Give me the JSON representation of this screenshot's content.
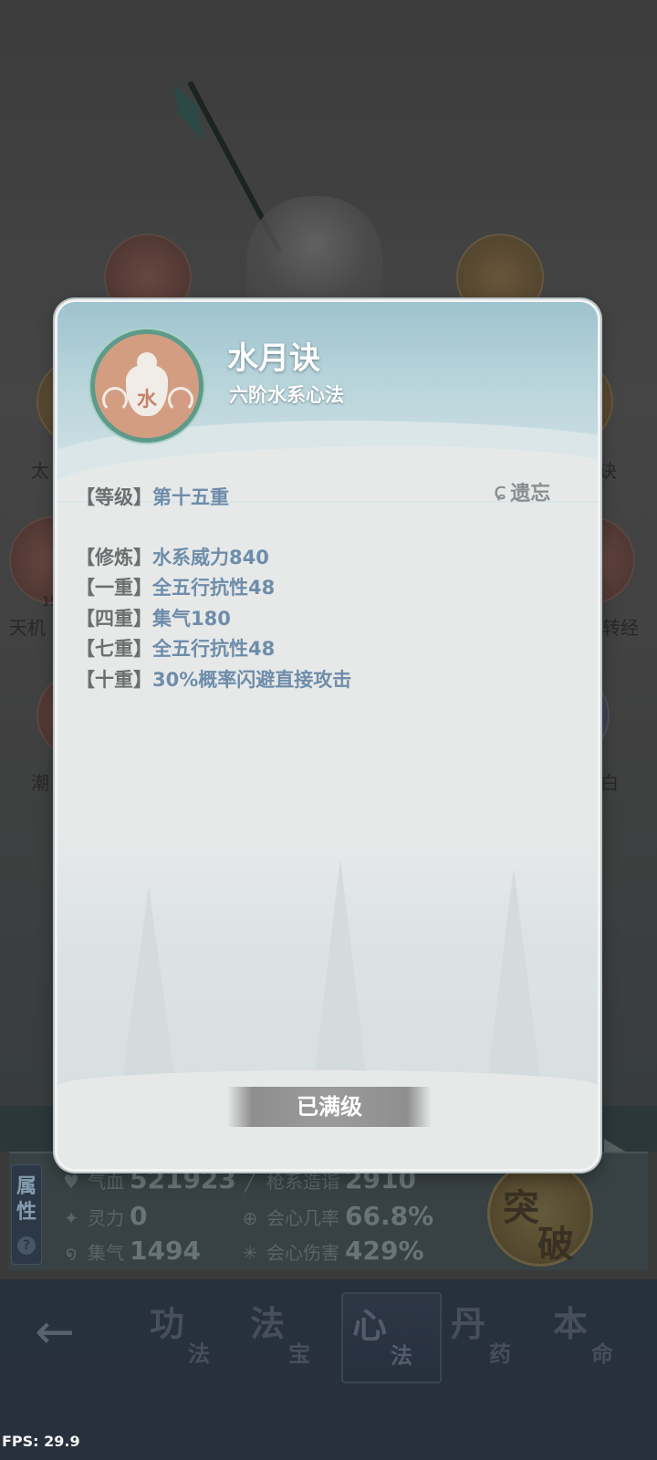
{
  "background": {
    "node_labels": [
      "太",
      "天机",
      "潮",
      "诀",
      "心转经",
      "白"
    ],
    "node_number_hint": "15"
  },
  "skill_modal": {
    "title": "水月诀",
    "subtitle": "六阶水系心法",
    "emblem_char": "水",
    "forget_label": "遗忘",
    "level_line": {
      "tag": "【等级】",
      "value": "第十五重"
    },
    "effects": [
      {
        "tag": "【修炼】",
        "value": "水系威力840"
      },
      {
        "tag": "【一重】",
        "value": "全五行抗性48"
      },
      {
        "tag": "【四重】",
        "value": "集气180"
      },
      {
        "tag": "【七重】",
        "value": "全五行抗性48"
      },
      {
        "tag": "【十重】",
        "value": "30%概率闪避直接攻击"
      }
    ],
    "maxed_label": "已满级"
  },
  "attributes": {
    "tag_label_1": "属",
    "tag_label_2": "性",
    "help_icon": "?",
    "stats": [
      {
        "icon": "heart-icon",
        "glyph": "♥",
        "label": "气血",
        "value": "521923"
      },
      {
        "icon": "spirit-flame-icon",
        "glyph": "✦",
        "label": "灵力",
        "value": "0"
      },
      {
        "icon": "swirl-icon",
        "glyph": "໑",
        "label": "集气",
        "value": "1494"
      },
      {
        "icon": "spear-icon",
        "glyph": "╱",
        "label": "枪系造诣",
        "value": "2910"
      },
      {
        "icon": "crit-target-icon",
        "glyph": "⊕",
        "label": "会心几率",
        "value": "66.8%"
      },
      {
        "icon": "burst-icon",
        "glyph": "✳",
        "label": "会心伤害",
        "value": "429%"
      }
    ],
    "breakthrough": {
      "char1": "突",
      "char2": "破"
    }
  },
  "bottom_nav": {
    "back_glyph": "←",
    "items": [
      {
        "big": "功",
        "small": "法",
        "active": false
      },
      {
        "big": "法",
        "small": "宝",
        "active": false
      },
      {
        "big": "心",
        "small": "法",
        "active": true
      },
      {
        "big": "丹",
        "small": "药",
        "active": false
      },
      {
        "big": "本",
        "small": "命",
        "active": false
      }
    ]
  },
  "fps": "FPS: 29.9",
  "colors": {
    "accent_value": "#6e8daa",
    "bracket_text": "#6d6e70",
    "emblem_bg": "#d39d82",
    "emblem_ring": "#5d9a8a",
    "header_top": "#9ec3ce"
  }
}
